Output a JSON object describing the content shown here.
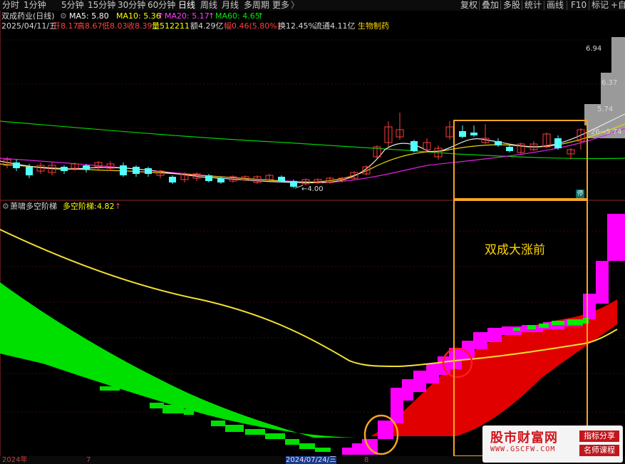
{
  "period_tabs": [
    "分时",
    "1分钟",
    "5分钟",
    "15分钟",
    "30分钟",
    "60分钟",
    "日线",
    "周线",
    "月线",
    "多周期",
    "更多"
  ],
  "active_tab": "日线",
  "right_tabs": [
    "复权",
    "叠加",
    "多股",
    "统计",
    "画线",
    "F10",
    "标记",
    "+自"
  ],
  "stock": {
    "title": "双成药业(日线)",
    "ma5_label": "MA5: 5.80",
    "ma10_label": "MA10: 5.36",
    "ma20_label": "MA20: 5.17",
    "ma60_label": "MA60: 4.65",
    "date": "2025/04/11/五",
    "open": "开8.17",
    "high": "高8.67",
    "low": "低8.03",
    "close": "收8.39",
    "volume": "量512211",
    "amount": "额4.29亿",
    "change": "幅0.46(5.80%)",
    "turnover": "换12.45%",
    "float": "流通4.11亿",
    "industry": "生物制药"
  },
  "price_labels": {
    "p694": "6.94",
    "p637": "6.37",
    "p574a": "5.74",
    "p574b": "26→5.74",
    "low_mark": "←4.00"
  },
  "indicator": {
    "title": "萧啸多空阶梯",
    "name_label": "多空阶梯:",
    "value": "4.82"
  },
  "annotation": "双成大涨前",
  "corner_tag": "停",
  "axis": {
    "year": "2024年",
    "seven": "7",
    "date": "2024/07/24/三",
    "eight": "8"
  },
  "logo": {
    "main": "股市财富网",
    "url": "WWW.GSCFW.COM",
    "tag1": "指标分享",
    "tag2": "名师课程"
  },
  "colors": {
    "up": "#ff3c3c",
    "down": "#54ffff",
    "ma5": "#ffffff",
    "ma10": "#ffff00",
    "ma20": "#ff00ff",
    "ma60": "#00e600",
    "ladder_bull": "#ff00ff",
    "ladder_bear": "#00ee00",
    "band_red": "#e00000",
    "yellow_line": "#ffeb3b",
    "highlight": "#f5a623"
  }
}
